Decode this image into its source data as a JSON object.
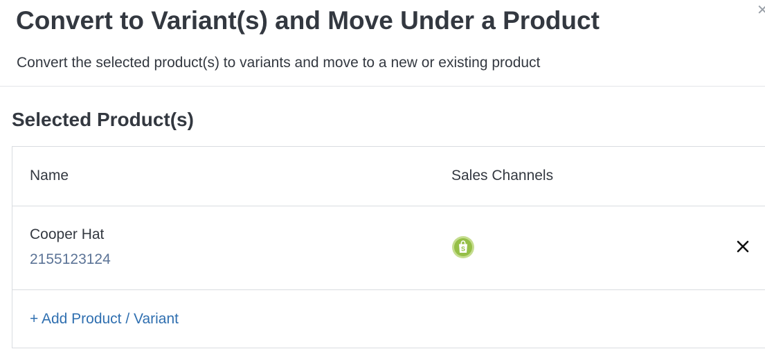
{
  "dialog": {
    "title": "Convert to Variant(s) and Move Under a Product",
    "subtitle": "Convert the selected product(s) to variants and move to a new or existing product",
    "close_icon": "close-icon"
  },
  "selected_products": {
    "section_title": "Selected Product(s)",
    "columns": {
      "name": "Name",
      "sales_channels": "Sales Channels"
    },
    "rows": [
      {
        "name": "Cooper Hat",
        "sku": "2155123124",
        "sales_channel_icon": "shopify-bag-icon",
        "remove_icon": "close-icon"
      }
    ],
    "add_link": "+ Add Product / Variant"
  },
  "colors": {
    "text": "#333840",
    "sku": "#5b7396",
    "link": "#2f6fb0",
    "shopify_green": "#95bf47",
    "border": "#d9dce0"
  }
}
